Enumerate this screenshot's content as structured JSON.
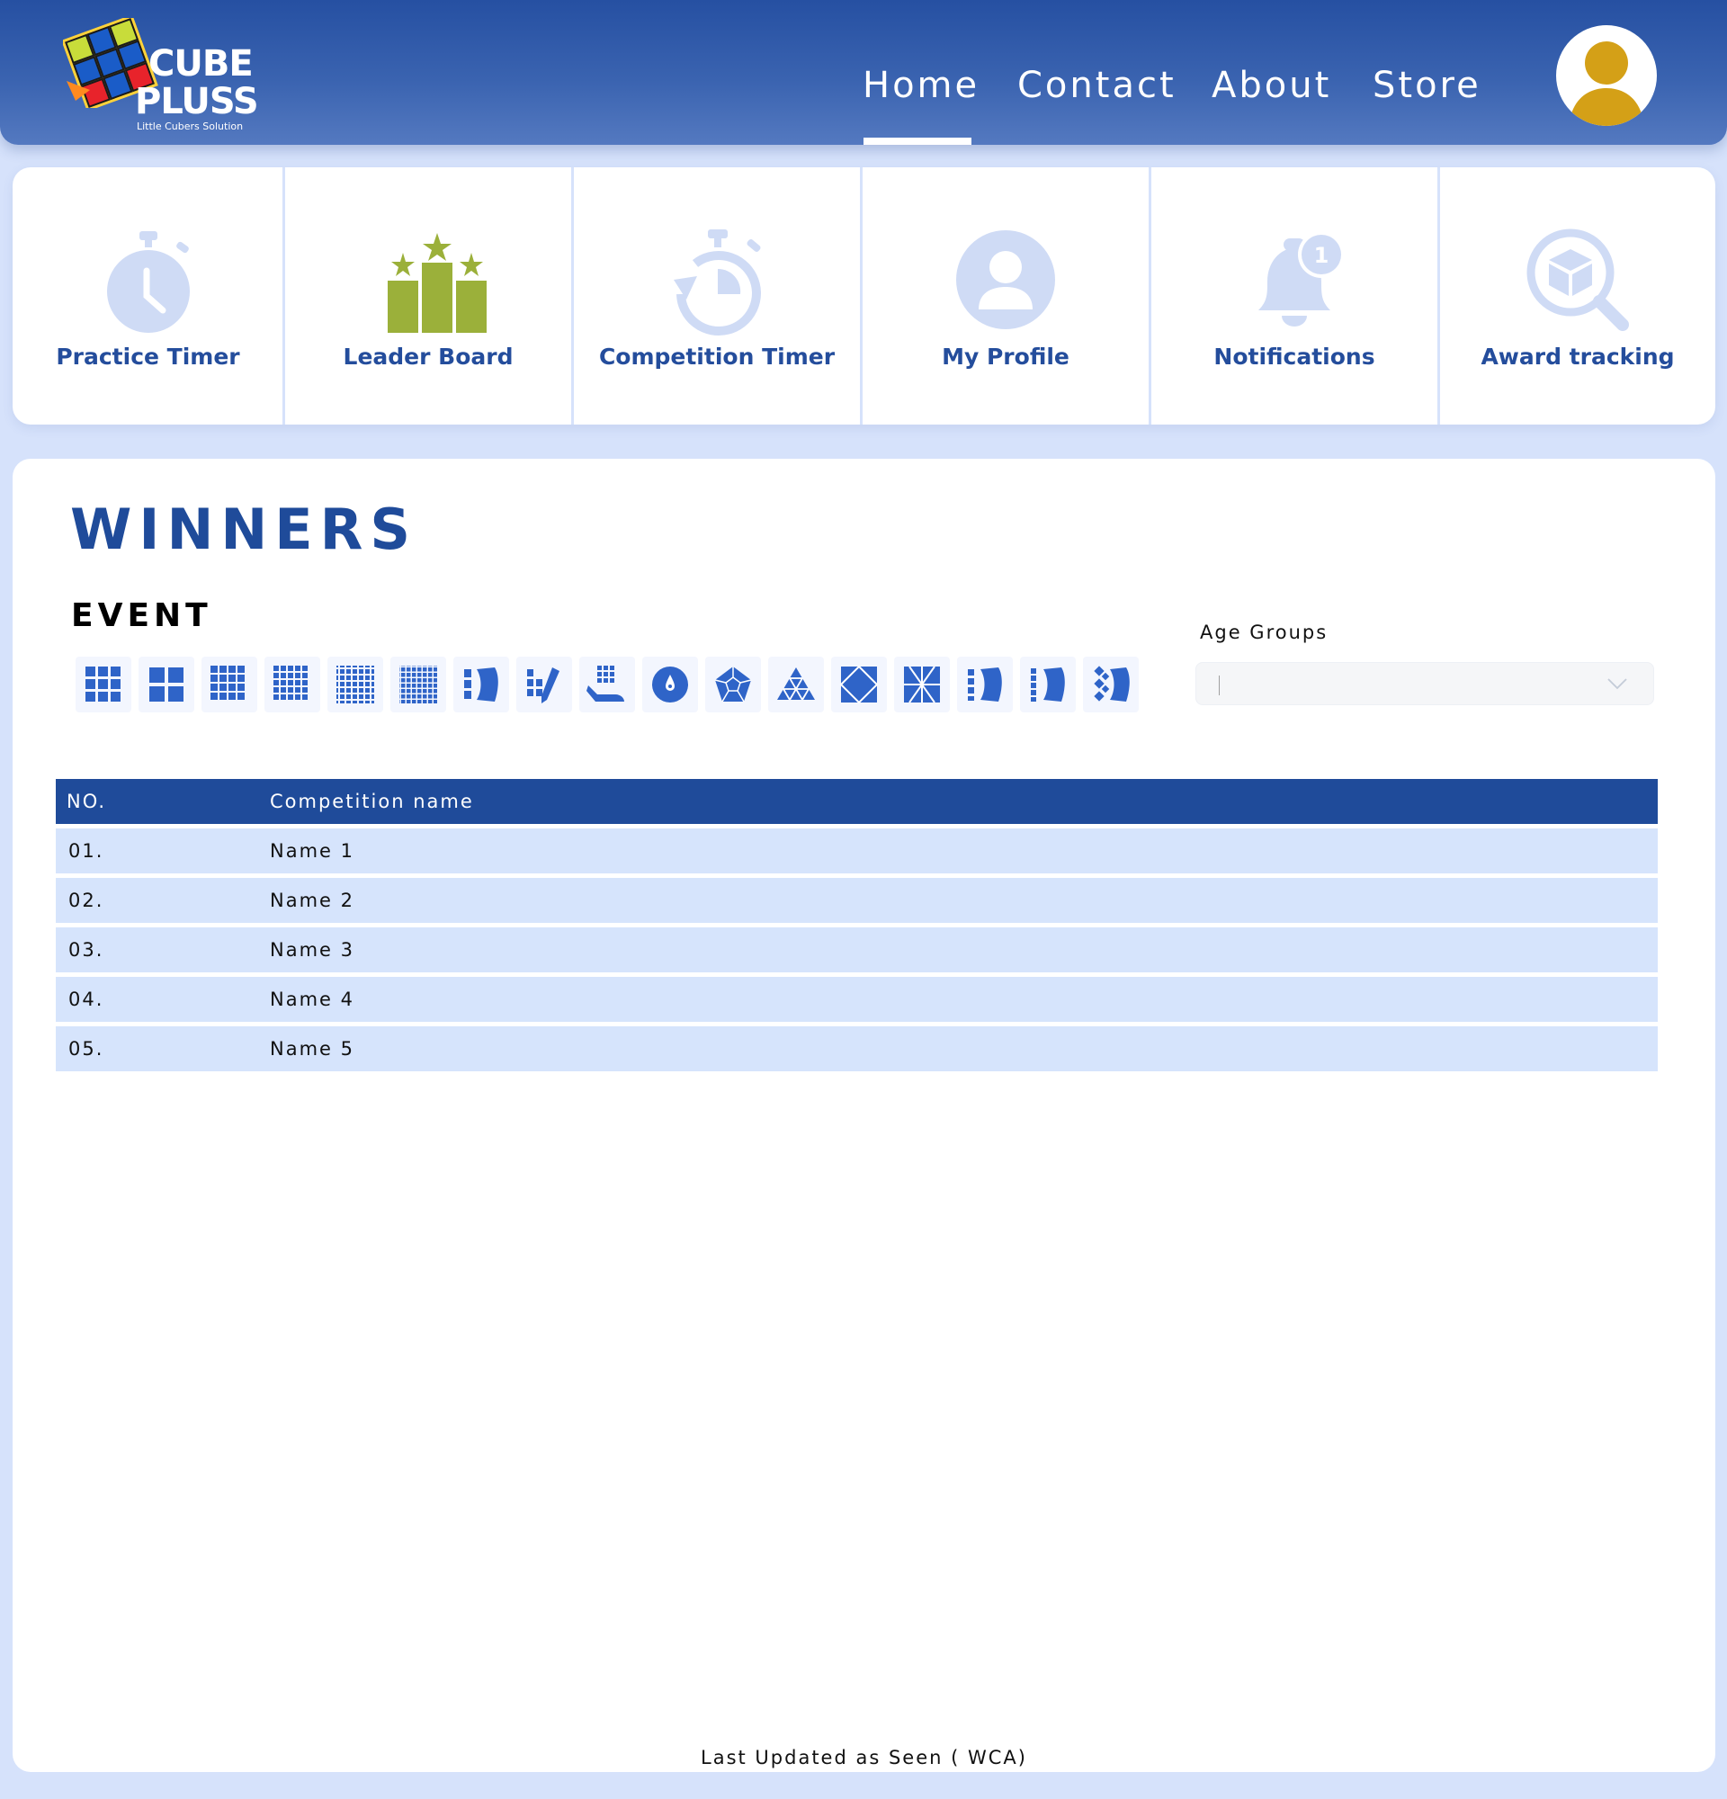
{
  "brand": {
    "line1": "CUBE",
    "line2": "PLUSS",
    "tagline": "Little Cubers Solution",
    "logo_colors": [
      "#ffd23a",
      "#ff8a1f",
      "#c8dc3a",
      "#1a5cc8",
      "#e8232b",
      "#f0f0f0"
    ]
  },
  "nav": {
    "items": [
      {
        "label": "Home",
        "active": true
      },
      {
        "label": "Contact",
        "active": false
      },
      {
        "label": "About",
        "active": false
      },
      {
        "label": "Store",
        "active": false
      }
    ]
  },
  "profile": {
    "icon": "user-avatar-icon",
    "color": "#d4a017"
  },
  "quick_links": [
    {
      "label": "Practice Timer",
      "icon": "stopwatch-icon"
    },
    {
      "label": "Leader Board",
      "icon": "podium-stars-icon"
    },
    {
      "label": "Competition Timer",
      "icon": "timer-reset-icon"
    },
    {
      "label": "My Profile",
      "icon": "user-circle-icon"
    },
    {
      "label": "Notifications",
      "icon": "bell-badge-icon",
      "badge": "1"
    },
    {
      "label": "Award tracking",
      "icon": "box-search-icon"
    }
  ],
  "colors": {
    "primary": "#1f4b9a",
    "accent_green": "#9bb03a",
    "icon_light": "#cfdbf5",
    "row_bg": "#d6e4fc",
    "page_bg": "#d6e2fb"
  },
  "winners": {
    "title": "WINNERS",
    "event_label": "EVENT",
    "events": [
      "cube-3x3-icon",
      "cube-2x2-icon",
      "cube-4x4-icon",
      "cube-5x5-icon",
      "cube-6x6-icon",
      "cube-7x7-icon",
      "cube-3x3-blindfolded-icon",
      "cube-fewest-moves-icon",
      "cube-one-handed-icon",
      "clock-icon",
      "megaminx-icon",
      "pyraminx-icon",
      "skewb-icon",
      "square-1-icon",
      "cube-4x4-blindfolded-icon",
      "cube-5x5-blindfolded-icon",
      "cube-multi-blind-icon"
    ],
    "age_groups_label": "Age Groups",
    "age_groups_value": ""
  },
  "table": {
    "headers": [
      "NO.",
      "Competition name"
    ],
    "rows": [
      {
        "no": "01.",
        "name": "Name 1"
      },
      {
        "no": "02.",
        "name": "Name 2"
      },
      {
        "no": "03.",
        "name": "Name 3"
      },
      {
        "no": "04.",
        "name": "Name 4"
      },
      {
        "no": "05.",
        "name": "Name 5"
      }
    ]
  },
  "footer": {
    "note": "Last Updated as Seen ( WCA)"
  }
}
